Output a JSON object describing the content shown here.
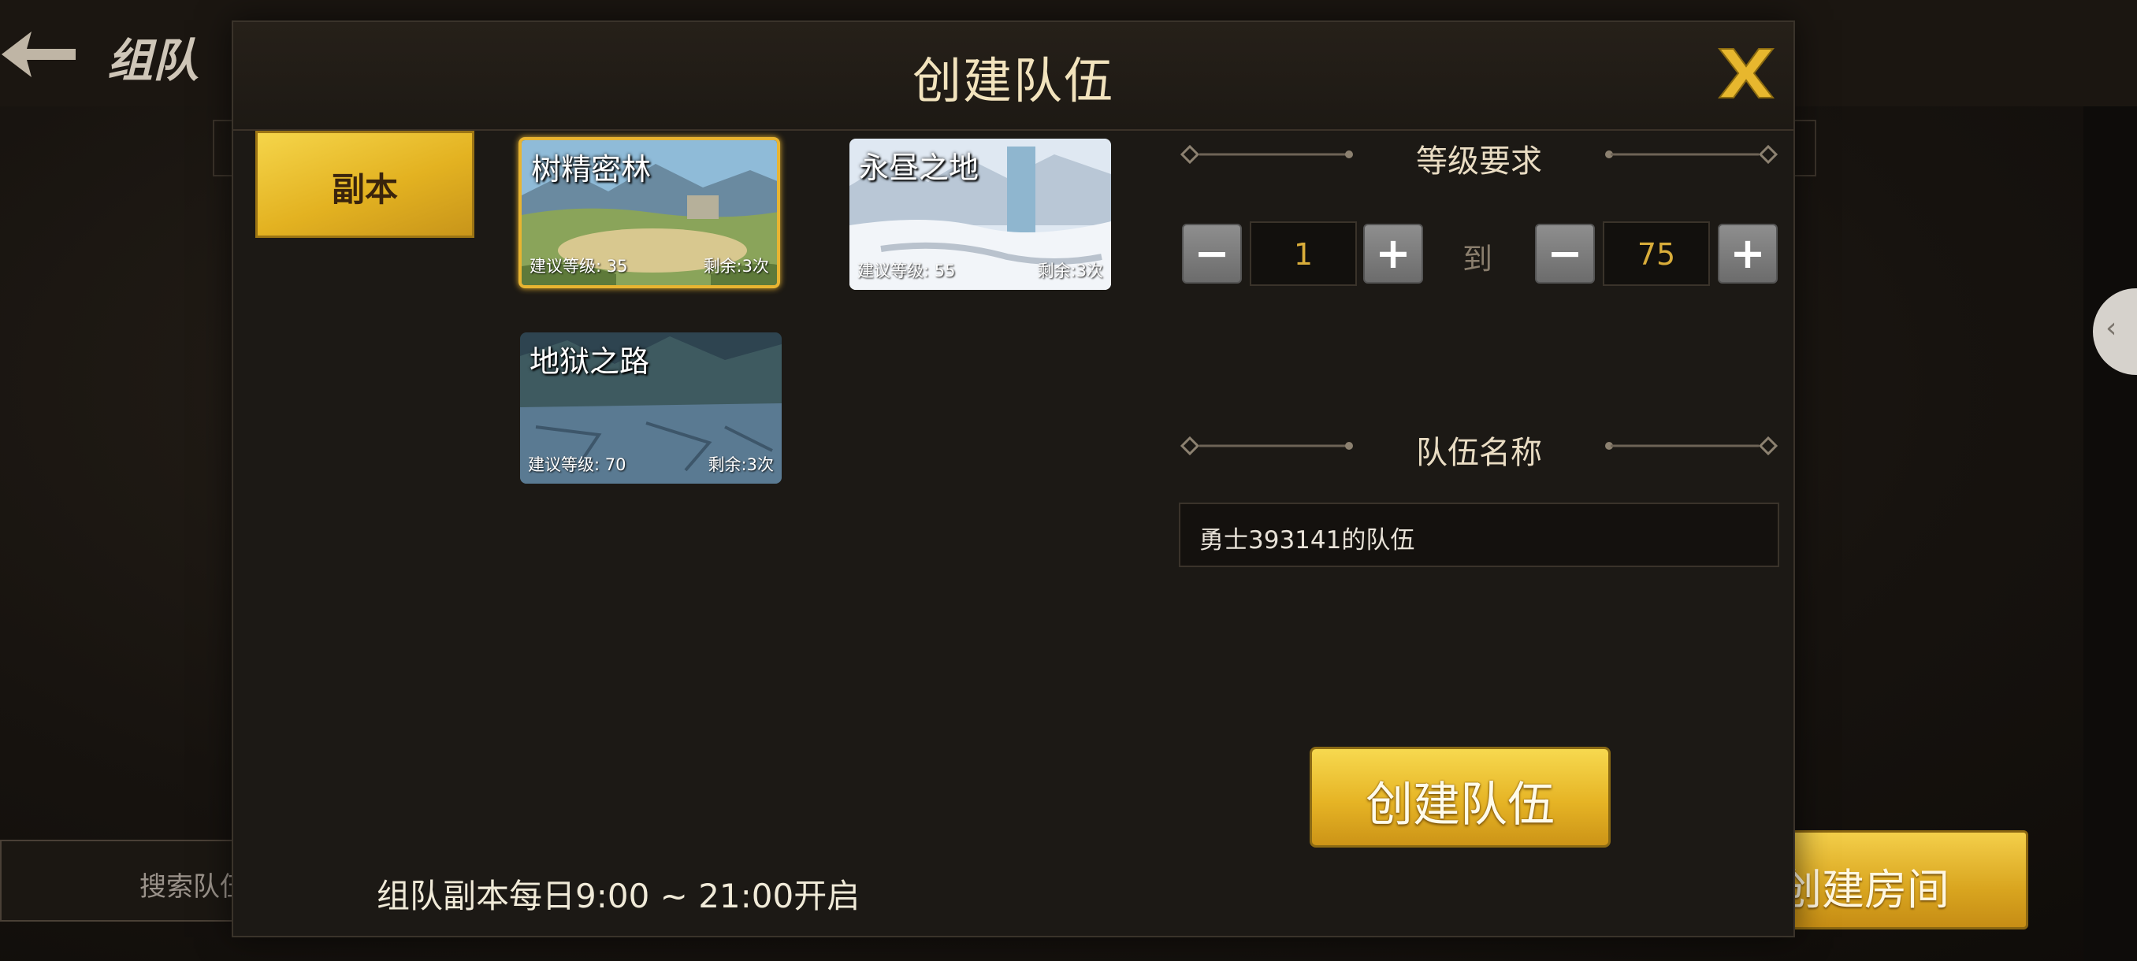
{
  "background": {
    "title": "组队",
    "search_placeholder": "搜索队伍",
    "create_room_label": "创建房间"
  },
  "modal": {
    "title": "创建队伍",
    "tabs": [
      {
        "label": "副本",
        "selected": true
      }
    ],
    "dungeons": [
      {
        "name": "树精密林",
        "level": "建议等级: 35",
        "remaining": "剩余:3次",
        "selected": true
      },
      {
        "name": "永昼之地",
        "level": "建议等级: 55",
        "remaining": "剩余:3次",
        "selected": false
      },
      {
        "name": "地狱之路",
        "level": "建议等级: 70",
        "remaining": "剩余:3次",
        "selected": false
      }
    ],
    "level_requirement": {
      "title": "等级要求",
      "min": "1",
      "to_label": "到",
      "max": "75",
      "minus_symbol": "−",
      "plus_symbol": "+"
    },
    "team_name": {
      "title": "队伍名称",
      "value": "勇士393141的队伍"
    },
    "create_button_label": "创建队伍",
    "footer_note": "组队副本每日9:00 ~ 21:00开启"
  },
  "colors": {
    "accent_gold": "#e6b425",
    "level_number": "#d9ad3a",
    "title_text": "#f2e3bd"
  }
}
